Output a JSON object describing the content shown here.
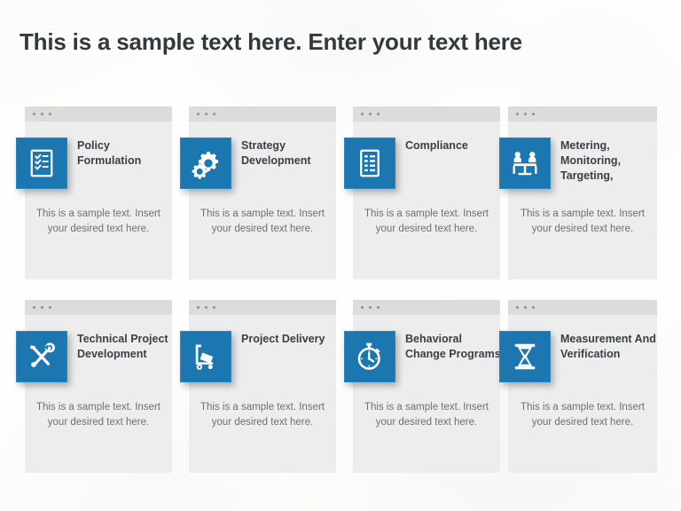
{
  "slide": {
    "title": "This is a sample text here. Enter your text here",
    "accent_color": "#1c76b0",
    "card_body_color": "#ededee",
    "card_header_color": "#dcdcdc",
    "title_color": "#33383c",
    "body_text_color": "#6c7072"
  },
  "cards": [
    {
      "title": "Policy Formulation",
      "body": "This is a sample text. Insert your desired text here.",
      "icon": "checklist-clipboard-icon"
    },
    {
      "title": "Strategy Development",
      "body": "This is a sample text. Insert your desired text here.",
      "icon": "gears-icon"
    },
    {
      "title": "Compliance",
      "body": "This is a sample text. Insert your desired text here.",
      "icon": "document-list-icon"
    },
    {
      "title": "Metering, Monitoring, Targeting,",
      "body": "This is a sample text. Insert your desired text here.",
      "icon": "people-at-table-icon"
    },
    {
      "title": "Technical Project Development",
      "body": "This is a sample text. Insert your desired text here.",
      "icon": "wrench-screwdriver-icon"
    },
    {
      "title": "Project Delivery",
      "body": "This is a sample text. Insert your desired text here.",
      "icon": "hand-truck-icon"
    },
    {
      "title": "Behavioral Change Programs",
      "body": "This is a sample text. Insert your desired text here.",
      "icon": "stopwatch-icon"
    },
    {
      "title": "Measurement And Verification",
      "body": "This is a sample text. Insert your desired text here.",
      "icon": "hourglass-icon"
    }
  ],
  "window_dots": [
    "dot",
    "dot",
    "dot"
  ]
}
